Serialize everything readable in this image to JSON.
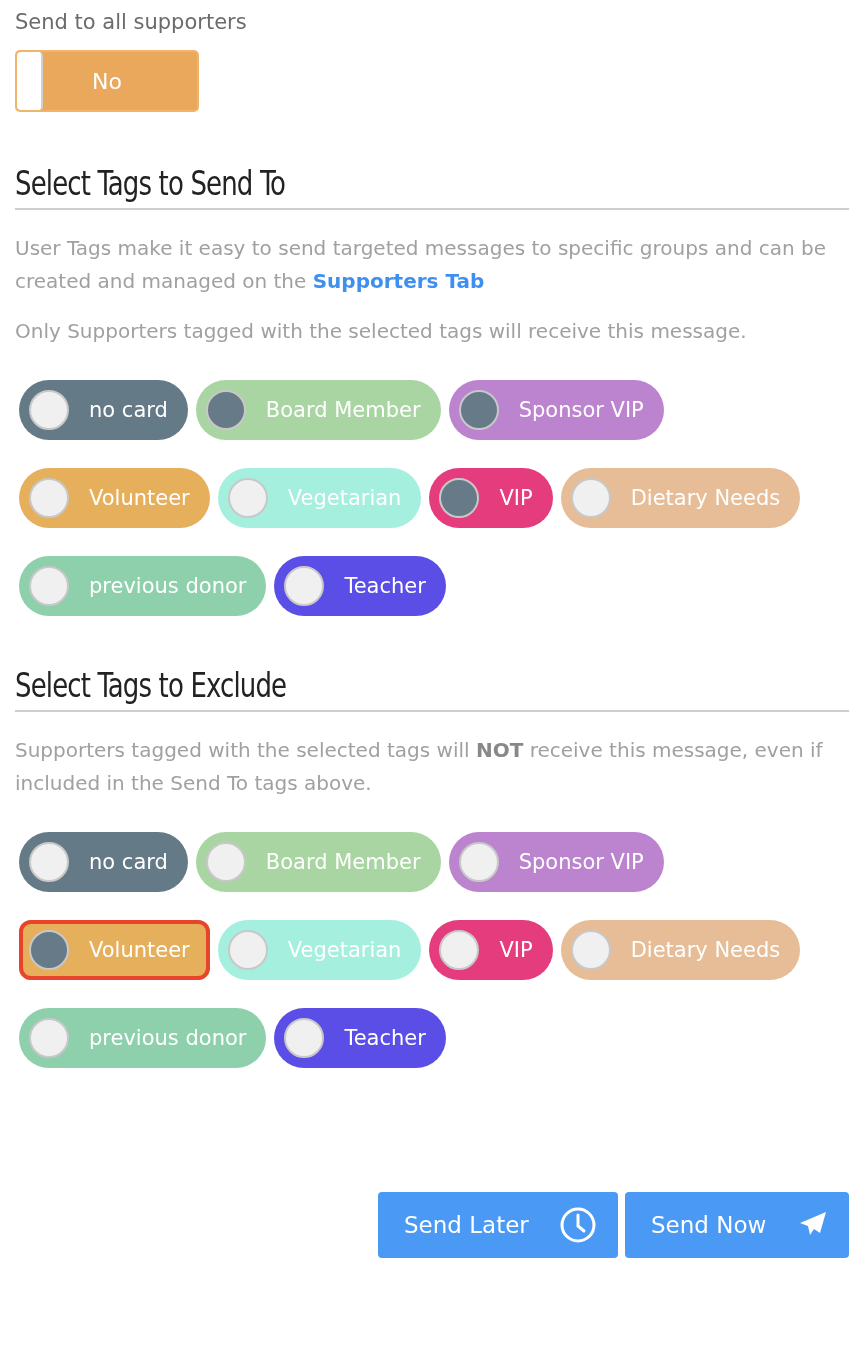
{
  "send_all": {
    "label": "Send to all supporters",
    "toggle": {
      "text": "No",
      "on": false
    }
  },
  "include": {
    "title": "Select Tags to Send To",
    "description": "User Tags make it easy to send targeted messages to specific groups and can be created and managed on the ",
    "link": "Supporters Tab",
    "note": "Only Supporters tagged with the selected tags will receive this message.",
    "tags": [
      {
        "label": "no card",
        "color": "#657a87",
        "selected": false,
        "outlined": false
      },
      {
        "label": "Board Member",
        "color": "#a8d5a1",
        "selected": true,
        "outlined": false
      },
      {
        "label": "Sponsor VIP",
        "color": "#bc83cf",
        "selected": true,
        "outlined": false
      },
      {
        "label": "Volunteer",
        "color": "#e6af5c",
        "selected": false,
        "outlined": false
      },
      {
        "label": "Vegetarian",
        "color": "#a5efdf",
        "selected": false,
        "outlined": false
      },
      {
        "label": "VIP",
        "color": "#e43c7c",
        "selected": true,
        "outlined": false
      },
      {
        "label": "Dietary Needs",
        "color": "#e6bd96",
        "selected": false,
        "outlined": false
      },
      {
        "label": "previous donor",
        "color": "#8dd0ab",
        "selected": false,
        "outlined": false
      },
      {
        "label": "Teacher",
        "color": "#5a4ee6",
        "selected": false,
        "outlined": false
      }
    ]
  },
  "exclude": {
    "title": "Select Tags to Exclude",
    "description": "Supporters tagged with the selected tags will **NOT** receive this message, even if included in the Send To tags above.",
    "tags": [
      {
        "label": "no card",
        "color": "#657a87",
        "selected": false,
        "outlined": false
      },
      {
        "label": "Board Member",
        "color": "#a8d5a1",
        "selected": false,
        "outlined": false
      },
      {
        "label": "Sponsor VIP",
        "color": "#bc83cf",
        "selected": false,
        "outlined": false
      },
      {
        "label": "Volunteer",
        "color": "#e6af5c",
        "selected": true,
        "outlined": true
      },
      {
        "label": "Vegetarian",
        "color": "#a5efdf",
        "selected": false,
        "outlined": false
      },
      {
        "label": "VIP",
        "color": "#e43c7c",
        "selected": false,
        "outlined": false
      },
      {
        "label": "Dietary Needs",
        "color": "#e6bd96",
        "selected": false,
        "outlined": false
      },
      {
        "label": "previous donor",
        "color": "#8dd0ab",
        "selected": false,
        "outlined": false
      },
      {
        "label": "Teacher",
        "color": "#5a4ee6",
        "selected": false,
        "outlined": false
      }
    ]
  },
  "buttons": [
    {
      "label": "Send Later",
      "kind": "later"
    },
    {
      "label": "Send Now",
      "kind": "now"
    }
  ]
}
